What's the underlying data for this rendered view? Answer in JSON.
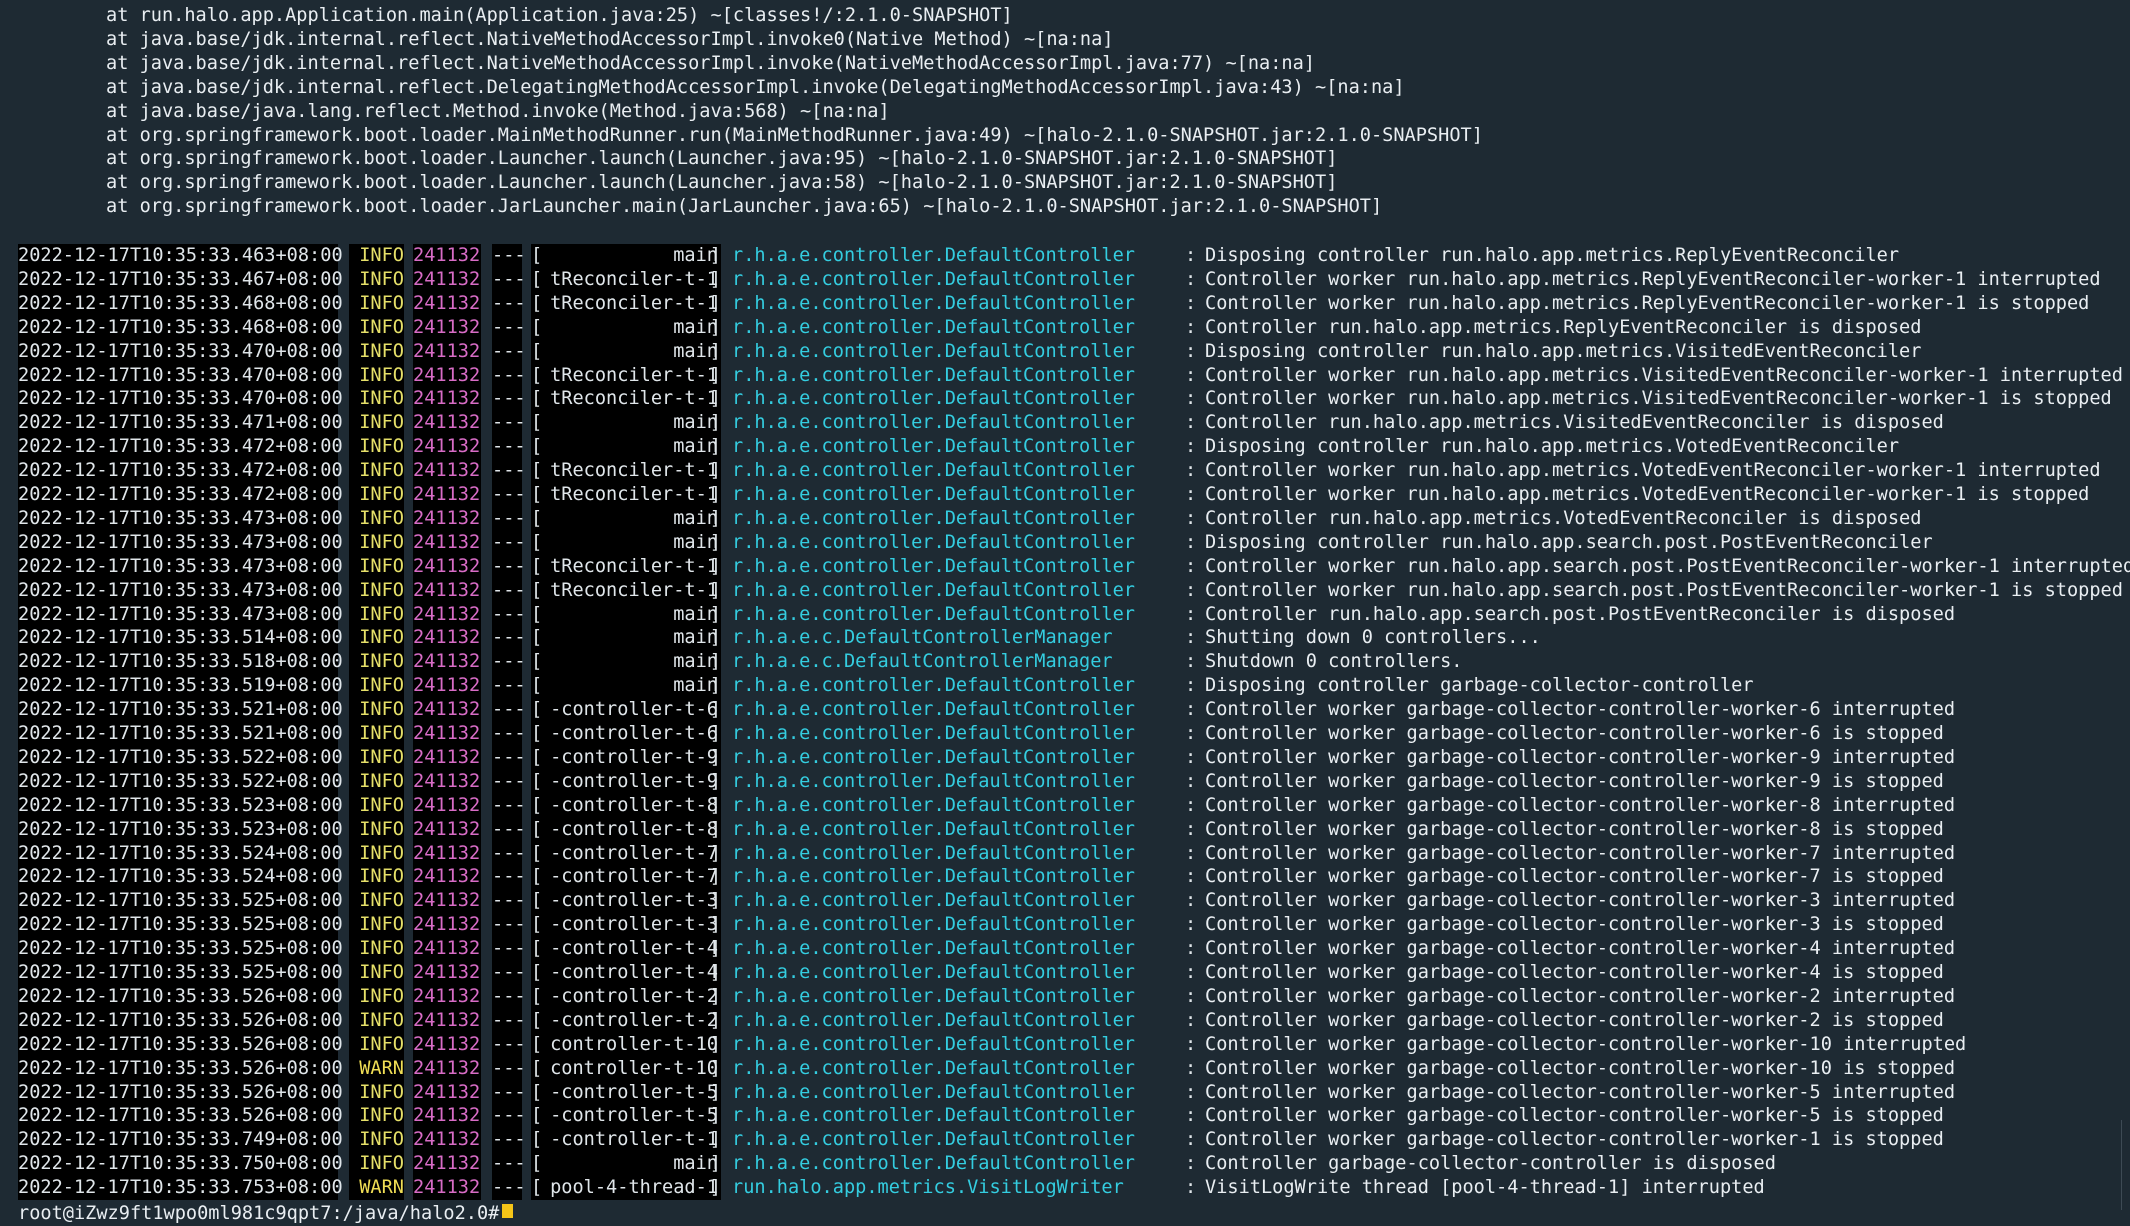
{
  "stack_lines": [
    "at run.halo.app.Application.main(Application.java:25) ~[classes!/:2.1.0-SNAPSHOT]",
    "at java.base/jdk.internal.reflect.NativeMethodAccessorImpl.invoke0(Native Method) ~[na:na]",
    "at java.base/jdk.internal.reflect.NativeMethodAccessorImpl.invoke(NativeMethodAccessorImpl.java:77) ~[na:na]",
    "at java.base/jdk.internal.reflect.DelegatingMethodAccessorImpl.invoke(DelegatingMethodAccessorImpl.java:43) ~[na:na]",
    "at java.base/java.lang.reflect.Method.invoke(Method.java:568) ~[na:na]",
    "at org.springframework.boot.loader.MainMethodRunner.run(MainMethodRunner.java:49) ~[halo-2.1.0-SNAPSHOT.jar:2.1.0-SNAPSHOT]",
    "at org.springframework.boot.loader.Launcher.launch(Launcher.java:95) ~[halo-2.1.0-SNAPSHOT.jar:2.1.0-SNAPSHOT]",
    "at org.springframework.boot.loader.Launcher.launch(Launcher.java:58) ~[halo-2.1.0-SNAPSHOT.jar:2.1.0-SNAPSHOT]",
    "at org.springframework.boot.loader.JarLauncher.main(JarLauncher.java:65) ~[halo-2.1.0-SNAPSHOT.jar:2.1.0-SNAPSHOT]"
  ],
  "log_rows": [
    {
      "ts": "2022-12-17T10:35:33.463+08:00",
      "level": "INFO",
      "pid": "241132",
      "sep": "---",
      "thread": "main",
      "logger": "r.h.a.e.controller.DefaultController",
      "message": "Disposing controller run.halo.app.metrics.ReplyEventReconciler"
    },
    {
      "ts": "2022-12-17T10:35:33.467+08:00",
      "level": "INFO",
      "pid": "241132",
      "sep": "---",
      "thread": "tReconciler-t-1",
      "logger": "r.h.a.e.controller.DefaultController",
      "message": "Controller worker run.halo.app.metrics.ReplyEventReconciler-worker-1 interrupted"
    },
    {
      "ts": "2022-12-17T10:35:33.468+08:00",
      "level": "INFO",
      "pid": "241132",
      "sep": "---",
      "thread": "tReconciler-t-1",
      "logger": "r.h.a.e.controller.DefaultController",
      "message": "Controller worker run.halo.app.metrics.ReplyEventReconciler-worker-1 is stopped"
    },
    {
      "ts": "2022-12-17T10:35:33.468+08:00",
      "level": "INFO",
      "pid": "241132",
      "sep": "---",
      "thread": "main",
      "logger": "r.h.a.e.controller.DefaultController",
      "message": "Controller run.halo.app.metrics.ReplyEventReconciler is disposed"
    },
    {
      "ts": "2022-12-17T10:35:33.470+08:00",
      "level": "INFO",
      "pid": "241132",
      "sep": "---",
      "thread": "main",
      "logger": "r.h.a.e.controller.DefaultController",
      "message": "Disposing controller run.halo.app.metrics.VisitedEventReconciler"
    },
    {
      "ts": "2022-12-17T10:35:33.470+08:00",
      "level": "INFO",
      "pid": "241132",
      "sep": "---",
      "thread": "tReconciler-t-1",
      "logger": "r.h.a.e.controller.DefaultController",
      "message": "Controller worker run.halo.app.metrics.VisitedEventReconciler-worker-1 interrupted"
    },
    {
      "ts": "2022-12-17T10:35:33.470+08:00",
      "level": "INFO",
      "pid": "241132",
      "sep": "---",
      "thread": "tReconciler-t-1",
      "logger": "r.h.a.e.controller.DefaultController",
      "message": "Controller worker run.halo.app.metrics.VisitedEventReconciler-worker-1 is stopped"
    },
    {
      "ts": "2022-12-17T10:35:33.471+08:00",
      "level": "INFO",
      "pid": "241132",
      "sep": "---",
      "thread": "main",
      "logger": "r.h.a.e.controller.DefaultController",
      "message": "Controller run.halo.app.metrics.VisitedEventReconciler is disposed"
    },
    {
      "ts": "2022-12-17T10:35:33.472+08:00",
      "level": "INFO",
      "pid": "241132",
      "sep": "---",
      "thread": "main",
      "logger": "r.h.a.e.controller.DefaultController",
      "message": "Disposing controller run.halo.app.metrics.VotedEventReconciler"
    },
    {
      "ts": "2022-12-17T10:35:33.472+08:00",
      "level": "INFO",
      "pid": "241132",
      "sep": "---",
      "thread": "tReconciler-t-1",
      "logger": "r.h.a.e.controller.DefaultController",
      "message": "Controller worker run.halo.app.metrics.VotedEventReconciler-worker-1 interrupted"
    },
    {
      "ts": "2022-12-17T10:35:33.472+08:00",
      "level": "INFO",
      "pid": "241132",
      "sep": "---",
      "thread": "tReconciler-t-1",
      "logger": "r.h.a.e.controller.DefaultController",
      "message": "Controller worker run.halo.app.metrics.VotedEventReconciler-worker-1 is stopped"
    },
    {
      "ts": "2022-12-17T10:35:33.473+08:00",
      "level": "INFO",
      "pid": "241132",
      "sep": "---",
      "thread": "main",
      "logger": "r.h.a.e.controller.DefaultController",
      "message": "Controller run.halo.app.metrics.VotedEventReconciler is disposed"
    },
    {
      "ts": "2022-12-17T10:35:33.473+08:00",
      "level": "INFO",
      "pid": "241132",
      "sep": "---",
      "thread": "main",
      "logger": "r.h.a.e.controller.DefaultController",
      "message": "Disposing controller run.halo.app.search.post.PostEventReconciler"
    },
    {
      "ts": "2022-12-17T10:35:33.473+08:00",
      "level": "INFO",
      "pid": "241132",
      "sep": "---",
      "thread": "tReconciler-t-1",
      "logger": "r.h.a.e.controller.DefaultController",
      "message": "Controller worker run.halo.app.search.post.PostEventReconciler-worker-1 interrupted"
    },
    {
      "ts": "2022-12-17T10:35:33.473+08:00",
      "level": "INFO",
      "pid": "241132",
      "sep": "---",
      "thread": "tReconciler-t-1",
      "logger": "r.h.a.e.controller.DefaultController",
      "message": "Controller worker run.halo.app.search.post.PostEventReconciler-worker-1 is stopped"
    },
    {
      "ts": "2022-12-17T10:35:33.473+08:00",
      "level": "INFO",
      "pid": "241132",
      "sep": "---",
      "thread": "main",
      "logger": "r.h.a.e.controller.DefaultController",
      "message": "Controller run.halo.app.search.post.PostEventReconciler is disposed"
    },
    {
      "ts": "2022-12-17T10:35:33.514+08:00",
      "level": "INFO",
      "pid": "241132",
      "sep": "---",
      "thread": "main",
      "logger": "r.h.a.e.c.DefaultControllerManager",
      "message": "Shutting down 0 controllers..."
    },
    {
      "ts": "2022-12-17T10:35:33.518+08:00",
      "level": "INFO",
      "pid": "241132",
      "sep": "---",
      "thread": "main",
      "logger": "r.h.a.e.c.DefaultControllerManager",
      "message": "Shutdown 0 controllers."
    },
    {
      "ts": "2022-12-17T10:35:33.519+08:00",
      "level": "INFO",
      "pid": "241132",
      "sep": "---",
      "thread": "main",
      "logger": "r.h.a.e.controller.DefaultController",
      "message": "Disposing controller garbage-collector-controller"
    },
    {
      "ts": "2022-12-17T10:35:33.521+08:00",
      "level": "INFO",
      "pid": "241132",
      "sep": "---",
      "thread": "-controller-t-6",
      "logger": "r.h.a.e.controller.DefaultController",
      "message": "Controller worker garbage-collector-controller-worker-6 interrupted"
    },
    {
      "ts": "2022-12-17T10:35:33.521+08:00",
      "level": "INFO",
      "pid": "241132",
      "sep": "---",
      "thread": "-controller-t-6",
      "logger": "r.h.a.e.controller.DefaultController",
      "message": "Controller worker garbage-collector-controller-worker-6 is stopped"
    },
    {
      "ts": "2022-12-17T10:35:33.522+08:00",
      "level": "INFO",
      "pid": "241132",
      "sep": "---",
      "thread": "-controller-t-9",
      "logger": "r.h.a.e.controller.DefaultController",
      "message": "Controller worker garbage-collector-controller-worker-9 interrupted"
    },
    {
      "ts": "2022-12-17T10:35:33.522+08:00",
      "level": "INFO",
      "pid": "241132",
      "sep": "---",
      "thread": "-controller-t-9",
      "logger": "r.h.a.e.controller.DefaultController",
      "message": "Controller worker garbage-collector-controller-worker-9 is stopped"
    },
    {
      "ts": "2022-12-17T10:35:33.523+08:00",
      "level": "INFO",
      "pid": "241132",
      "sep": "---",
      "thread": "-controller-t-8",
      "logger": "r.h.a.e.controller.DefaultController",
      "message": "Controller worker garbage-collector-controller-worker-8 interrupted"
    },
    {
      "ts": "2022-12-17T10:35:33.523+08:00",
      "level": "INFO",
      "pid": "241132",
      "sep": "---",
      "thread": "-controller-t-8",
      "logger": "r.h.a.e.controller.DefaultController",
      "message": "Controller worker garbage-collector-controller-worker-8 is stopped"
    },
    {
      "ts": "2022-12-17T10:35:33.524+08:00",
      "level": "INFO",
      "pid": "241132",
      "sep": "---",
      "thread": "-controller-t-7",
      "logger": "r.h.a.e.controller.DefaultController",
      "message": "Controller worker garbage-collector-controller-worker-7 interrupted"
    },
    {
      "ts": "2022-12-17T10:35:33.524+08:00",
      "level": "INFO",
      "pid": "241132",
      "sep": "---",
      "thread": "-controller-t-7",
      "logger": "r.h.a.e.controller.DefaultController",
      "message": "Controller worker garbage-collector-controller-worker-7 is stopped"
    },
    {
      "ts": "2022-12-17T10:35:33.525+08:00",
      "level": "INFO",
      "pid": "241132",
      "sep": "---",
      "thread": "-controller-t-3",
      "logger": "r.h.a.e.controller.DefaultController",
      "message": "Controller worker garbage-collector-controller-worker-3 interrupted"
    },
    {
      "ts": "2022-12-17T10:35:33.525+08:00",
      "level": "INFO",
      "pid": "241132",
      "sep": "---",
      "thread": "-controller-t-3",
      "logger": "r.h.a.e.controller.DefaultController",
      "message": "Controller worker garbage-collector-controller-worker-3 is stopped"
    },
    {
      "ts": "2022-12-17T10:35:33.525+08:00",
      "level": "INFO",
      "pid": "241132",
      "sep": "---",
      "thread": "-controller-t-4",
      "logger": "r.h.a.e.controller.DefaultController",
      "message": "Controller worker garbage-collector-controller-worker-4 interrupted"
    },
    {
      "ts": "2022-12-17T10:35:33.525+08:00",
      "level": "INFO",
      "pid": "241132",
      "sep": "---",
      "thread": "-controller-t-4",
      "logger": "r.h.a.e.controller.DefaultController",
      "message": "Controller worker garbage-collector-controller-worker-4 is stopped"
    },
    {
      "ts": "2022-12-17T10:35:33.526+08:00",
      "level": "INFO",
      "pid": "241132",
      "sep": "---",
      "thread": "-controller-t-2",
      "logger": "r.h.a.e.controller.DefaultController",
      "message": "Controller worker garbage-collector-controller-worker-2 interrupted"
    },
    {
      "ts": "2022-12-17T10:35:33.526+08:00",
      "level": "INFO",
      "pid": "241132",
      "sep": "---",
      "thread": "-controller-t-2",
      "logger": "r.h.a.e.controller.DefaultController",
      "message": "Controller worker garbage-collector-controller-worker-2 is stopped"
    },
    {
      "ts": "2022-12-17T10:35:33.526+08:00",
      "level": "INFO",
      "pid": "241132",
      "sep": "---",
      "thread": "controller-t-10",
      "logger": "r.h.a.e.controller.DefaultController",
      "message": "Controller worker garbage-collector-controller-worker-10 interrupted"
    },
    {
      "ts": "2022-12-17T10:35:33.526+08:00",
      "level": "WARN",
      "pid": "241132",
      "sep": "---",
      "thread": "controller-t-10",
      "logger": "r.h.a.e.controller.DefaultController",
      "message": "Controller worker garbage-collector-controller-worker-10 is stopped"
    },
    {
      "ts": "2022-12-17T10:35:33.526+08:00",
      "level": "INFO",
      "pid": "241132",
      "sep": "---",
      "thread": "-controller-t-5",
      "logger": "r.h.a.e.controller.DefaultController",
      "message": "Controller worker garbage-collector-controller-worker-5 interrupted"
    },
    {
      "ts": "2022-12-17T10:35:33.526+08:00",
      "level": "INFO",
      "pid": "241132",
      "sep": "---",
      "thread": "-controller-t-5",
      "logger": "r.h.a.e.controller.DefaultController",
      "message": "Controller worker garbage-collector-controller-worker-5 is stopped"
    },
    {
      "ts": "2022-12-17T10:35:33.749+08:00",
      "level": "INFO",
      "pid": "241132",
      "sep": "---",
      "thread": "-controller-t-1",
      "logger": "r.h.a.e.controller.DefaultController",
      "message": "Controller worker garbage-collector-controller-worker-1 is stopped"
    },
    {
      "ts": "2022-12-17T10:35:33.750+08:00",
      "level": "INFO",
      "pid": "241132",
      "sep": "---",
      "thread": "main",
      "logger": "r.h.a.e.controller.DefaultController",
      "message": "Controller garbage-collector-controller is disposed"
    },
    {
      "ts": "2022-12-17T10:35:33.753+08:00",
      "level": "WARN",
      "pid": "241132",
      "sep": "---",
      "thread": "pool-4-thread-1",
      "logger": "run.halo.app.metrics.VisitLogWriter",
      "message": "VisitLogWrite thread [pool-4-thread-1] interrupted"
    }
  ],
  "prompt": "root@iZwz9ft1wpo0ml981c9qpt7:/java/halo2.0#",
  "colors": {
    "background": "#1e2a33",
    "info": "#e6e069",
    "warn": "#f0de55",
    "pid": "#d86cc6",
    "logger": "#34cde0",
    "cursor": "#f5c518"
  }
}
